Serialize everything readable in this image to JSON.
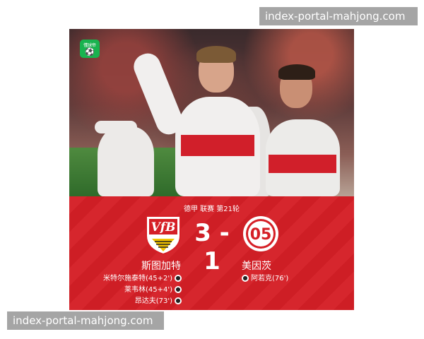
{
  "watermarks": {
    "top": "index-portal-mahjong.com",
    "bottom": "index-portal-mahjong.com"
  },
  "corner_badge": {
    "text": "懂球帝",
    "icon": "soccer-ball-icon"
  },
  "match": {
    "league": "德甲 联赛 第21轮",
    "score": "3 - 1",
    "home": {
      "name": "斯图加特",
      "crest_text": "VfB",
      "scorers": [
        "米特尔施泰特(45+2')",
        "莱韦林(45+4')",
        "昂达夫(73')"
      ]
    },
    "away": {
      "name": "美因茨",
      "crest_text": "05",
      "scorers": [
        "阿若克(76')"
      ]
    }
  },
  "colors": {
    "panel": "#d51f26",
    "badge": "#19b34f",
    "watermark_bg": "#8c8c8c"
  }
}
